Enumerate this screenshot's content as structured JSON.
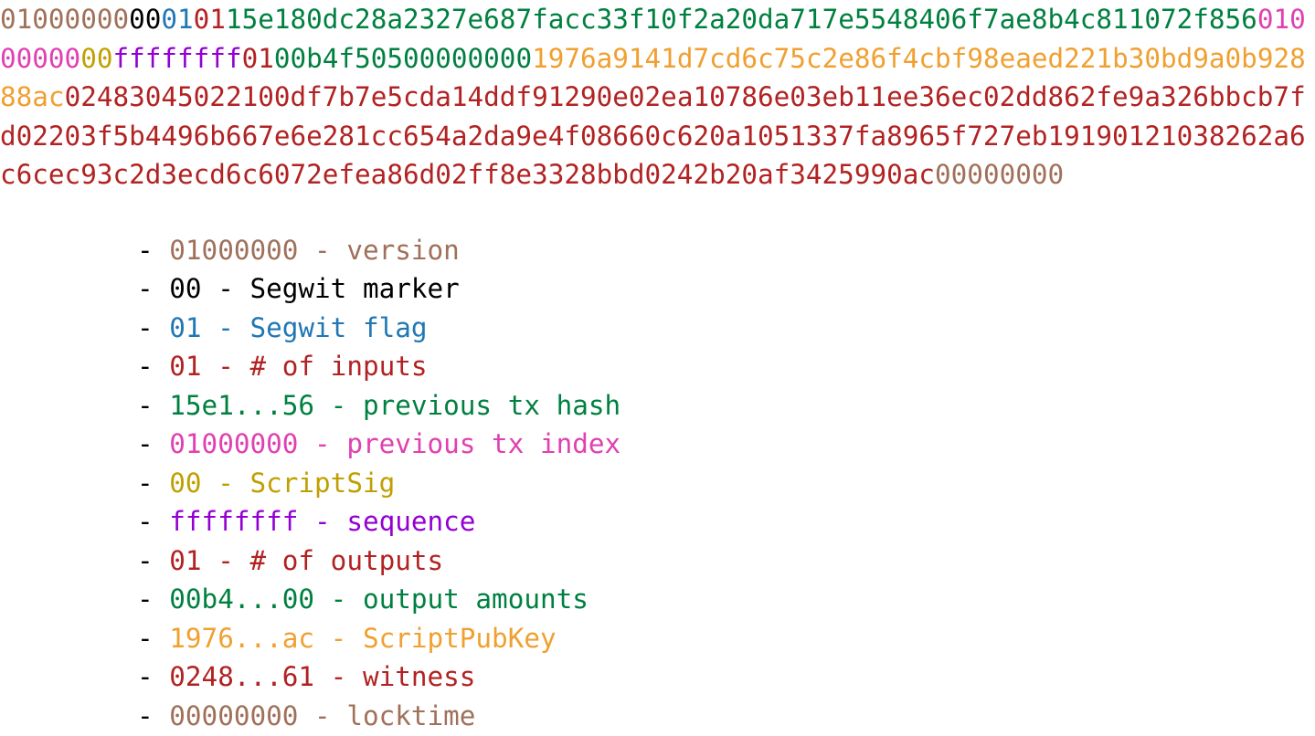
{
  "colors": {
    "version": "#a0705a",
    "segwit_marker": "#000000",
    "segwit_flag": "#1f77b4",
    "count": "#b22222",
    "hash_and_amounts": "#008040",
    "prev_index": "#e040b0",
    "scriptsig": "#c0a000",
    "sequence": "#9400d3",
    "scriptpubkey": "#f0a030",
    "witness": "#b22222",
    "locktime": "#a0705a"
  },
  "hex_lines": [
    [
      {
        "text": "01000000",
        "color": "c-version"
      },
      {
        "text": "00",
        "color": "c-marker"
      },
      {
        "text": "01",
        "color": "c-flag"
      },
      {
        "text": "01",
        "color": "c-count"
      },
      {
        "text": "15e180dc28a2327e687facc33f10f2a20da717e5548406f7ae8b4c811072f856",
        "color": "c-green"
      },
      {
        "text": "010",
        "color": "c-pink"
      }
    ],
    [
      {
        "text": "00000",
        "color": "c-pink"
      },
      {
        "text": "00",
        "color": "c-olive"
      },
      {
        "text": "ffffffff",
        "color": "c-purple"
      },
      {
        "text": "01",
        "color": "c-count"
      },
      {
        "text": "00b4f50500000000",
        "color": "c-green"
      },
      {
        "text": "1976a9141d7cd6c75c2e86f4cbf98eaed221b30bd9a0b928",
        "color": "c-orange"
      }
    ],
    [
      {
        "text": "88ac",
        "color": "c-orange"
      },
      {
        "text": "02483045022100df7b7e5cda14ddf91290e02ea10786e03eb11ee36ec02dd862fe9a326bbcb7f",
        "color": "c-witness"
      }
    ],
    [
      {
        "text": "d02203f5b4496b667e6e281cc654a2da9e4f08660c620a1051337fa8965f727eb19190121038262a6",
        "color": "c-witness"
      }
    ],
    [
      {
        "text": "c6cec93c2d3ecd6c6072efea86d02ff8e3328bbd0242b20af3425990ac",
        "color": "c-witness"
      },
      {
        "text": "00000000",
        "color": "c-version"
      }
    ]
  ],
  "legend": [
    {
      "code": "01000000",
      "label": "version",
      "color": "c-version"
    },
    {
      "code": "00",
      "label": "Segwit marker",
      "color": "c-marker"
    },
    {
      "code": "01",
      "label": "Segwit flag",
      "color": "c-flag"
    },
    {
      "code": "01",
      "label": "# of inputs",
      "color": "c-count"
    },
    {
      "code": "15e1...56",
      "label": "previous tx hash",
      "color": "c-green"
    },
    {
      "code": "01000000",
      "label": "previous tx index",
      "color": "c-pink"
    },
    {
      "code": "00",
      "label": "ScriptSig",
      "color": "c-olive"
    },
    {
      "code": "ffffffff",
      "label": "sequence",
      "color": "c-purple"
    },
    {
      "code": "01",
      "label": "# of outputs",
      "color": "c-count"
    },
    {
      "code": "00b4...00",
      "label": "output amounts",
      "color": "c-green"
    },
    {
      "code": "1976...ac",
      "label": "ScriptPubKey",
      "color": "c-orange"
    },
    {
      "code": "0248...61",
      "label": "witness",
      "color": "c-witness"
    },
    {
      "code": "00000000",
      "label": "locktime",
      "color": "c-version"
    }
  ]
}
